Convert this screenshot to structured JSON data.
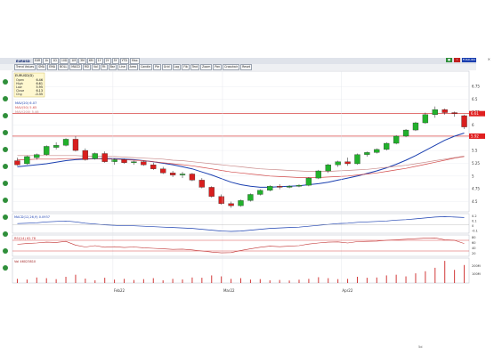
{
  "toolbar": {
    "symbol": "EURUSD",
    "row1": [
      "EUR",
      "1h",
      "1D",
      "10D",
      "1M",
      "3M",
      "6M",
      "1Y",
      "2Y",
      "5Y",
      "YTD",
      "Max"
    ],
    "row2": [
      "Trend Values",
      "SMA",
      "EMA",
      "BOLL",
      "MACD",
      "RSI",
      "Vol",
      "Fit",
      "Bar",
      "Line",
      "Area",
      "Candle",
      "Pie",
      "Grid",
      "Log",
      "Fib",
      "Text",
      "Zoom",
      "Pan",
      "Crosshair",
      "Reset"
    ],
    "right_label": "FUSD-IDX"
  },
  "info_panel": {
    "title": "EURUSD(D)",
    "rows": [
      [
        "Open",
        "6.46"
      ],
      [
        "High",
        "6.61"
      ],
      [
        "Low",
        "5.95"
      ],
      [
        "Close",
        "6.13"
      ],
      [
        "Chg",
        "-0.35"
      ]
    ]
  },
  "indicator_legend": {
    "lines": [
      {
        "label": "MAV(20)",
        "value": "6.07",
        "color": "#1a3fb0"
      },
      {
        "label": "MAV(50)",
        "value": "5.65",
        "color": "#d24a4a"
      },
      {
        "label": "MAV(200)",
        "value": "5.46",
        "color": "#c98a8a"
      }
    ]
  },
  "price_tags": [
    {
      "value": "6.61",
      "color": "#e02020"
    },
    {
      "value": "5.92",
      "color": "#e02020"
    }
  ],
  "macd": {
    "label": "MACD(12,26,9)",
    "value": "0.0937",
    "axis": [
      "0.2",
      "0.1",
      "0",
      "-0.1"
    ]
  },
  "rsi": {
    "label": "RSI(14)",
    "value": "62.78",
    "axis": [
      "80",
      "60",
      "40",
      "20"
    ]
  },
  "volume": {
    "label": "Vol",
    "value": "46023810",
    "axis": [
      "200M",
      "100M"
    ]
  },
  "status": "5d",
  "chart_data": {
    "type": "candlestick",
    "x_labels": [
      "Feb22",
      "Mar22",
      "Apr22"
    ],
    "ylim": [
      4.3,
      7.05
    ],
    "y_ticks": [
      "6.75",
      "6.5",
      "6.25",
      "6",
      "5.75",
      "5.5",
      "5.25",
      "5",
      "4.75",
      "4.5"
    ],
    "horizontal_lines": [
      6.22,
      5.78
    ],
    "candles": [
      [
        5.3,
        5.36,
        5.2,
        5.22
      ],
      [
        5.24,
        5.4,
        5.22,
        5.38
      ],
      [
        5.36,
        5.44,
        5.32,
        5.42
      ],
      [
        5.42,
        5.6,
        5.4,
        5.58
      ],
      [
        5.56,
        5.66,
        5.52,
        5.6
      ],
      [
        5.6,
        5.74,
        5.58,
        5.72
      ],
      [
        5.72,
        5.78,
        5.48,
        5.5
      ],
      [
        5.5,
        5.54,
        5.3,
        5.32
      ],
      [
        5.34,
        5.46,
        5.32,
        5.44
      ],
      [
        5.44,
        5.48,
        5.26,
        5.28
      ],
      [
        5.28,
        5.34,
        5.22,
        5.32
      ],
      [
        5.32,
        5.34,
        5.24,
        5.26
      ],
      [
        5.26,
        5.3,
        5.22,
        5.28
      ],
      [
        5.28,
        5.3,
        5.2,
        5.22
      ],
      [
        5.22,
        5.26,
        5.12,
        5.14
      ],
      [
        5.14,
        5.18,
        5.04,
        5.06
      ],
      [
        5.06,
        5.1,
        4.98,
        5.02
      ],
      [
        5.02,
        5.08,
        4.96,
        5.04
      ],
      [
        5.04,
        5.06,
        4.9,
        4.92
      ],
      [
        4.92,
        4.96,
        4.76,
        4.78
      ],
      [
        4.78,
        4.8,
        4.58,
        4.6
      ],
      [
        4.6,
        4.64,
        4.44,
        4.46
      ],
      [
        4.46,
        4.5,
        4.38,
        4.42
      ],
      [
        4.42,
        4.54,
        4.4,
        4.52
      ],
      [
        4.52,
        4.66,
        4.5,
        4.64
      ],
      [
        4.64,
        4.74,
        4.62,
        4.72
      ],
      [
        4.72,
        4.82,
        4.7,
        4.8
      ],
      [
        4.8,
        4.84,
        4.74,
        4.78
      ],
      [
        4.78,
        4.82,
        4.76,
        4.8
      ],
      [
        4.8,
        4.84,
        4.78,
        4.82
      ],
      [
        4.82,
        4.98,
        4.8,
        4.96
      ],
      [
        4.96,
        5.12,
        4.94,
        5.1
      ],
      [
        5.1,
        5.24,
        5.06,
        5.22
      ],
      [
        5.22,
        5.3,
        5.18,
        5.28
      ],
      [
        5.28,
        5.36,
        5.2,
        5.24
      ],
      [
        5.24,
        5.44,
        5.22,
        5.42
      ],
      [
        5.42,
        5.48,
        5.38,
        5.46
      ],
      [
        5.46,
        5.54,
        5.44,
        5.52
      ],
      [
        5.52,
        5.66,
        5.5,
        5.64
      ],
      [
        5.64,
        5.8,
        5.62,
        5.78
      ],
      [
        5.78,
        5.92,
        5.76,
        5.9
      ],
      [
        5.9,
        6.06,
        5.88,
        6.04
      ],
      [
        6.04,
        6.24,
        6.02,
        6.2
      ],
      [
        6.2,
        6.36,
        6.14,
        6.3
      ],
      [
        6.3,
        6.32,
        6.2,
        6.24
      ],
      [
        6.24,
        6.26,
        6.16,
        6.22
      ],
      [
        6.18,
        6.2,
        5.92,
        5.96
      ]
    ],
    "ma_lines": [
      {
        "name": "MAV(20)",
        "color": "#1a3fb0",
        "values": [
          5.18,
          5.2,
          5.22,
          5.24,
          5.27,
          5.3,
          5.32,
          5.33,
          5.34,
          5.34,
          5.34,
          5.33,
          5.32,
          5.3,
          5.28,
          5.25,
          5.22,
          5.18,
          5.14,
          5.08,
          5.02,
          4.95,
          4.88,
          4.83,
          4.8,
          4.78,
          4.78,
          4.79,
          4.8,
          4.81,
          4.83,
          4.85,
          4.88,
          4.92,
          4.96,
          5.0,
          5.05,
          5.1,
          5.16,
          5.23,
          5.31,
          5.4,
          5.5,
          5.6,
          5.7,
          5.78,
          5.84
        ]
      },
      {
        "name": "MAV(50)",
        "color": "#d24a4a",
        "values": [
          5.32,
          5.32,
          5.33,
          5.33,
          5.33,
          5.34,
          5.34,
          5.34,
          5.34,
          5.33,
          5.33,
          5.32,
          5.31,
          5.3,
          5.28,
          5.26,
          5.24,
          5.22,
          5.2,
          5.17,
          5.14,
          5.11,
          5.08,
          5.06,
          5.04,
          5.02,
          5.0,
          4.99,
          4.98,
          4.97,
          4.97,
          4.97,
          4.98,
          4.99,
          5.0,
          5.02,
          5.04,
          5.06,
          5.09,
          5.12,
          5.15,
          5.19,
          5.23,
          5.27,
          5.31,
          5.35,
          5.38
        ]
      },
      {
        "name": "MAV(200)",
        "color": "#c98a8a",
        "values": [
          5.4,
          5.4,
          5.4,
          5.4,
          5.4,
          5.4,
          5.4,
          5.39,
          5.39,
          5.38,
          5.38,
          5.37,
          5.36,
          5.35,
          5.34,
          5.33,
          5.31,
          5.3,
          5.28,
          5.26,
          5.24,
          5.22,
          5.2,
          5.18,
          5.16,
          5.14,
          5.13,
          5.12,
          5.11,
          5.1,
          5.09,
          5.09,
          5.09,
          5.1,
          5.11,
          5.12,
          5.13,
          5.15,
          5.17,
          5.19,
          5.21,
          5.24,
          5.27,
          5.3,
          5.33,
          5.36,
          5.39
        ]
      }
    ],
    "macd_values": [
      0.02,
      0.03,
      0.04,
      0.06,
      0.07,
      0.08,
      0.06,
      0.03,
      0.01,
      -0.01,
      -0.02,
      -0.03,
      -0.03,
      -0.04,
      -0.05,
      -0.06,
      -0.07,
      -0.08,
      -0.09,
      -0.11,
      -0.13,
      -0.15,
      -0.16,
      -0.15,
      -0.13,
      -0.11,
      -0.09,
      -0.08,
      -0.07,
      -0.06,
      -0.04,
      -0.02,
      0.0,
      0.02,
      0.03,
      0.05,
      0.06,
      0.07,
      0.08,
      0.1,
      0.11,
      0.13,
      0.15,
      0.17,
      0.18,
      0.17,
      0.16
    ],
    "rsi_values": [
      55,
      58,
      60,
      63,
      62,
      66,
      52,
      45,
      50,
      44,
      46,
      43,
      45,
      42,
      40,
      38,
      36,
      37,
      34,
      30,
      26,
      23,
      24,
      32,
      38,
      44,
      48,
      46,
      48,
      50,
      56,
      60,
      63,
      64,
      60,
      65,
      66,
      67,
      70,
      72,
      74,
      76,
      78,
      79,
      72,
      70,
      58
    ],
    "volume_values": [
      30,
      25,
      40,
      35,
      28,
      45,
      60,
      32,
      20,
      38,
      25,
      30,
      22,
      28,
      35,
      20,
      30,
      26,
      40,
      38,
      55,
      48,
      30,
      35,
      25,
      28,
      20,
      22,
      18,
      24,
      30,
      42,
      35,
      28,
      30,
      45,
      38,
      40,
      55,
      60,
      48,
      70,
      85,
      110,
      160,
      95,
      130
    ]
  }
}
